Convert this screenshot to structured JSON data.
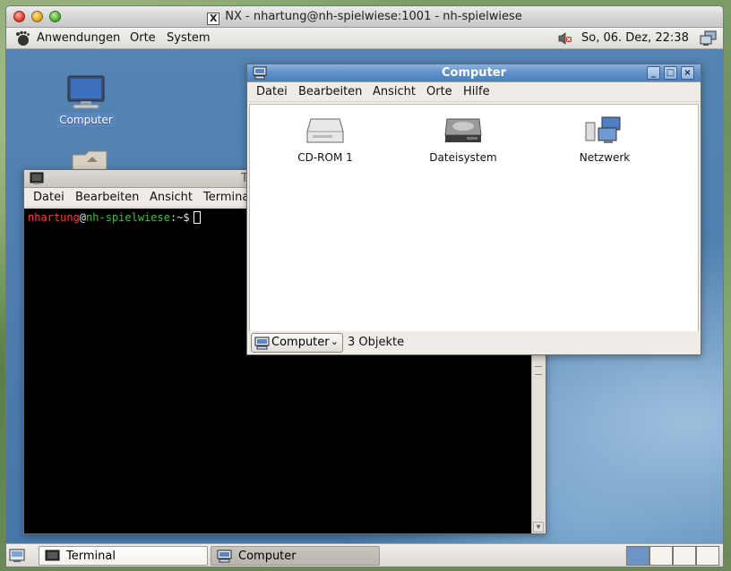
{
  "nx_window": {
    "title": "NX - nhartung@nh-spielwiese:1001 - nh-spielwiese",
    "title_icon_letter": "X"
  },
  "top_panel": {
    "menus": [
      "Anwendungen",
      "Orte",
      "System"
    ],
    "clock": "So, 06. Dez, 22:38",
    "icons": [
      "gnome-foot-icon",
      "speaker-muted-icon",
      "network-icon"
    ]
  },
  "desktop": {
    "icons": [
      {
        "label": "Computer",
        "icon": "computer-icon"
      },
      {
        "label": "",
        "icon": "folder-icon"
      }
    ]
  },
  "terminal": {
    "title": "T",
    "menu": [
      "Datei",
      "Bearbeiten",
      "Ansicht",
      "Termina"
    ],
    "prompt": {
      "user": "nhartung",
      "at": "@",
      "host": "nh-spielwiese",
      "rest": ":~$"
    },
    "colors": {
      "user": "#ff3b3b",
      "host": "#3fbf3f",
      "background": "#000000"
    }
  },
  "file_manager": {
    "title": "Computer",
    "menu": [
      "Datei",
      "Bearbeiten",
      "Ansicht",
      "Orte",
      "Hilfe"
    ],
    "items": [
      {
        "label": "CD-ROM 1",
        "icon": "cdrom-icon"
      },
      {
        "label": "Dateisystem",
        "icon": "harddisk-icon"
      },
      {
        "label": "Netzwerk",
        "icon": "network-computers-icon"
      }
    ],
    "location": "Computer",
    "status": "3 Objekte",
    "window_buttons": [
      "_",
      "□",
      "×"
    ]
  },
  "bottom_panel": {
    "tasks": [
      {
        "label": "Terminal",
        "icon": "terminal-icon",
        "active": false
      },
      {
        "label": "Computer",
        "icon": "computer-icon",
        "active": true
      }
    ],
    "workspaces": 4,
    "current_workspace": 1
  },
  "accent": "#5f90c8"
}
